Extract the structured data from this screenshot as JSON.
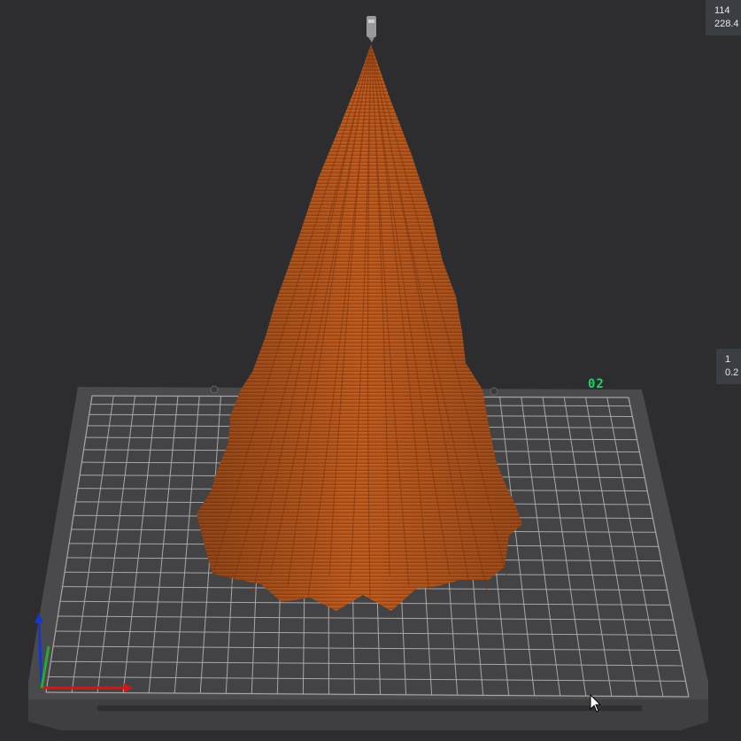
{
  "viewport": {
    "background": "#2d2d2f",
    "plate_label": "02",
    "plate_label_color": "#1fd16a",
    "model_color": "#b4561e",
    "plate_color": "#4a4a4c",
    "grid_color": "#b9b9b9"
  },
  "readouts": {
    "top_line1": "114",
    "top_line2": "228.4",
    "mid_line1": "1",
    "mid_line2": "0.2"
  },
  "icons": {
    "nozzle": "nozzle-icon",
    "axes": "axis-gizmo-icon",
    "cursor": "mouse-cursor-icon"
  }
}
